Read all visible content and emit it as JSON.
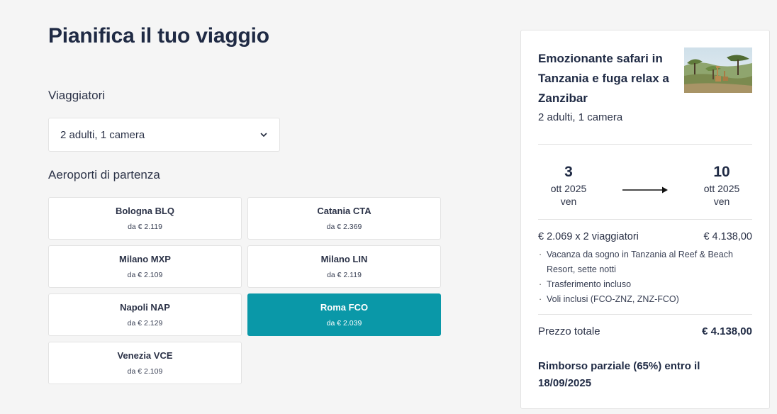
{
  "page_title": "Pianifica il tuo viaggio",
  "travelers": {
    "label": "Viaggiatori",
    "selected": "2 adulti, 1 camera"
  },
  "airports": {
    "label": "Aeroporti di partenza",
    "items": [
      {
        "name": "Bologna BLQ",
        "price": "da € 2.119",
        "selected": false
      },
      {
        "name": "Catania CTA",
        "price": "da € 2.369",
        "selected": false
      },
      {
        "name": "Milano MXP",
        "price": "da € 2.109",
        "selected": false
      },
      {
        "name": "Milano LIN",
        "price": "da € 2.119",
        "selected": false
      },
      {
        "name": "Napoli NAP",
        "price": "da € 2.129",
        "selected": false
      },
      {
        "name": "Roma FCO",
        "price": "da € 2.039",
        "selected": true
      },
      {
        "name": "Venezia VCE",
        "price": "da € 2.109",
        "selected": false
      }
    ]
  },
  "summary": {
    "title": "Emozionante safari in Tanzania e fuga relax a Zanzibar",
    "subtitle": "2 adulti, 1 camera",
    "start": {
      "day": "3",
      "month": "ott 2025",
      "weekday": "ven"
    },
    "end": {
      "day": "10",
      "month": "ott 2025",
      "weekday": "ven"
    },
    "price_breakdown": "€ 2.069 x 2 viaggiatori",
    "price_breakdown_total": "€ 4.138,00",
    "included": [
      "Vacanza da sogno in Tanzania al Reef & Beach Resort, sette notti",
      "Trasferimento incluso",
      "Voli inclusi (FCO-ZNZ, ZNZ-FCO)"
    ],
    "total_label": "Prezzo totale",
    "total_value": "€ 4.138,00",
    "refund_text": "Rimborso parziale (65%) entro il 18/09/2025"
  },
  "colors": {
    "accent": "#0a98a8",
    "text": "#1f2a44",
    "background": "#f5f5f5"
  }
}
